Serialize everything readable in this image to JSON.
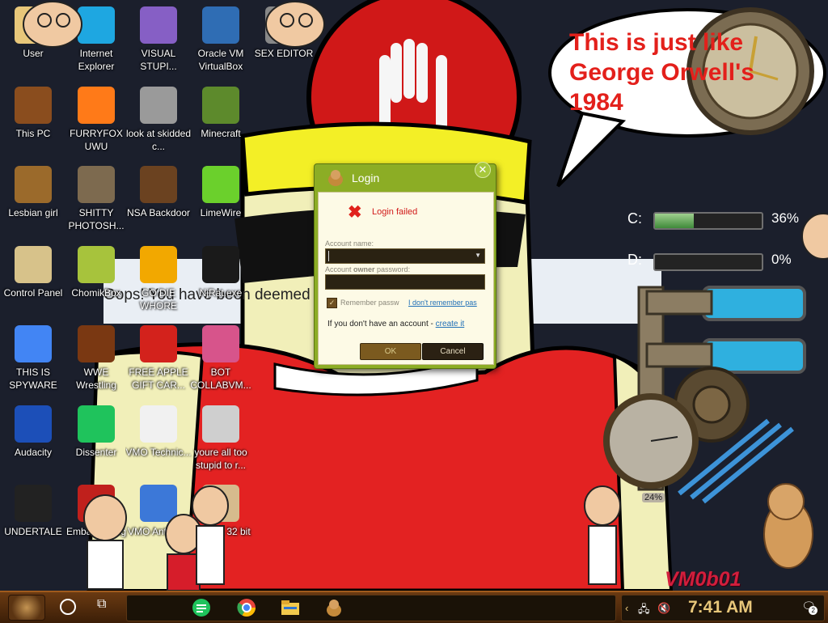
{
  "wallpaper": {
    "speech_bubble": "This is just like George Orwell's 1984",
    "blocked_message": "Oops! You have been deemed inappropriate",
    "signature": "VM0b01"
  },
  "desktop_icons": [
    {
      "label": "User",
      "icon": "user-folder-icon",
      "color": "#e8c77a"
    },
    {
      "label": "Internet Explorer",
      "icon": "edge-icon",
      "color": "#1ea7e1"
    },
    {
      "label": "VISUAL STUPI...",
      "icon": "visual-studio-icon",
      "color": "#865fc5"
    },
    {
      "label": "Oracle VM VirtualBox",
      "icon": "virtualbox-icon",
      "color": "#2f6db4"
    },
    {
      "label": "SEX EDITOR",
      "icon": "editor-icon",
      "color": "#888888"
    },
    {
      "label": "This PC",
      "icon": "computer-icon",
      "color": "#8a4d1e"
    },
    {
      "label": "FURRYFOX UWU",
      "icon": "firefox-icon",
      "color": "#ff7a18"
    },
    {
      "label": "look at skidded c...",
      "icon": "copy-icon",
      "color": "#9a9a9a"
    },
    {
      "label": "Minecraft",
      "icon": "minecraft-icon",
      "color": "#5d8a2c"
    },
    {
      "label": "Lesbian girl",
      "icon": "folder-icon",
      "color": "#9b6a2b"
    },
    {
      "label": "SHITTY PHOTOSH...",
      "icon": "gimp-icon",
      "color": "#7d6a4f"
    },
    {
      "label": "NSA Backdoor",
      "icon": "chest-icon",
      "color": "#6b4220"
    },
    {
      "label": "LimeWire",
      "icon": "limewire-icon",
      "color": "#6bd02c"
    },
    {
      "label": "Control Panel",
      "icon": "lamp-icon",
      "color": "#d7c28a"
    },
    {
      "label": "ChomikBox",
      "icon": "chomikbox-icon",
      "color": "#a7c33c"
    },
    {
      "label": "GO DIE WHORE",
      "icon": "adobe-de-icon",
      "color": "#f2a800"
    },
    {
      "label": "NjRat.exe",
      "icon": "skull-icon",
      "color": "#1a1a1a"
    },
    {
      "label": "THIS IS SPYWARE",
      "icon": "chrome-icon",
      "color": "#4285f4"
    },
    {
      "label": "WWE Wrestling",
      "icon": "tv-icon",
      "color": "#7a3812"
    },
    {
      "label": "FREE APPLE GIFT CAR...",
      "icon": "apple-icon",
      "color": "#d3221c"
    },
    {
      "label": "BOT COLLABVM...",
      "icon": "monitor-icon",
      "color": "#d7548b"
    },
    {
      "label": "Audacity",
      "icon": "audacity-icon",
      "color": "#1c4fb8"
    },
    {
      "label": "Dissenter",
      "icon": "dissenter-icon",
      "color": "#1fc35c"
    },
    {
      "label": "VMO Technic...",
      "icon": "doctor-icon",
      "color": "#f1f1f1"
    },
    {
      "label": "youre all too stupid to r...",
      "icon": "portrait-icon",
      "color": "#cfcfcf"
    },
    {
      "label": "UNDERTALE",
      "icon": "unity-icon",
      "color": "#222222"
    },
    {
      "label": "Embarrassing Dev",
      "icon": "embarcadero-icon",
      "color": "#c0201c"
    },
    {
      "label": "VMO Antivirus",
      "icon": "shield-icon",
      "color": "#3c78d8"
    },
    {
      "label": "Revolut 32 bit",
      "icon": "app-icon",
      "color": "#d6bb8d"
    }
  ],
  "login_dialog": {
    "title": "Login",
    "error": "Login failed",
    "account_label": "Account name:",
    "password_label_pre": "Account ",
    "password_label_bold": "owner",
    "password_label_post": " password:",
    "remember": "Remember passw",
    "forgot": "I don't remember pas",
    "no_account": "If you don't have an account - ",
    "create_link": "create it",
    "ok": "OK",
    "cancel": "Cancel"
  },
  "drives": [
    {
      "label": "C:",
      "percent_text": "36%",
      "fraction": 0.36
    },
    {
      "label": "D:",
      "percent_text": "0%",
      "fraction": 0.0
    }
  ],
  "cpu_gauge": {
    "percent_text": "24%"
  },
  "taskbar": {
    "apps": [
      {
        "name": "dissenter-taskbar-icon",
        "color": "#1fc35c"
      },
      {
        "name": "chrome-taskbar-icon",
        "color": "#4285f4"
      },
      {
        "name": "file-explorer-taskbar-icon",
        "color": "#f2c94c"
      },
      {
        "name": "hamster-taskbar-icon",
        "color": "#c48a3b"
      }
    ],
    "clock": "7:41 AM",
    "notification_count": "2"
  }
}
